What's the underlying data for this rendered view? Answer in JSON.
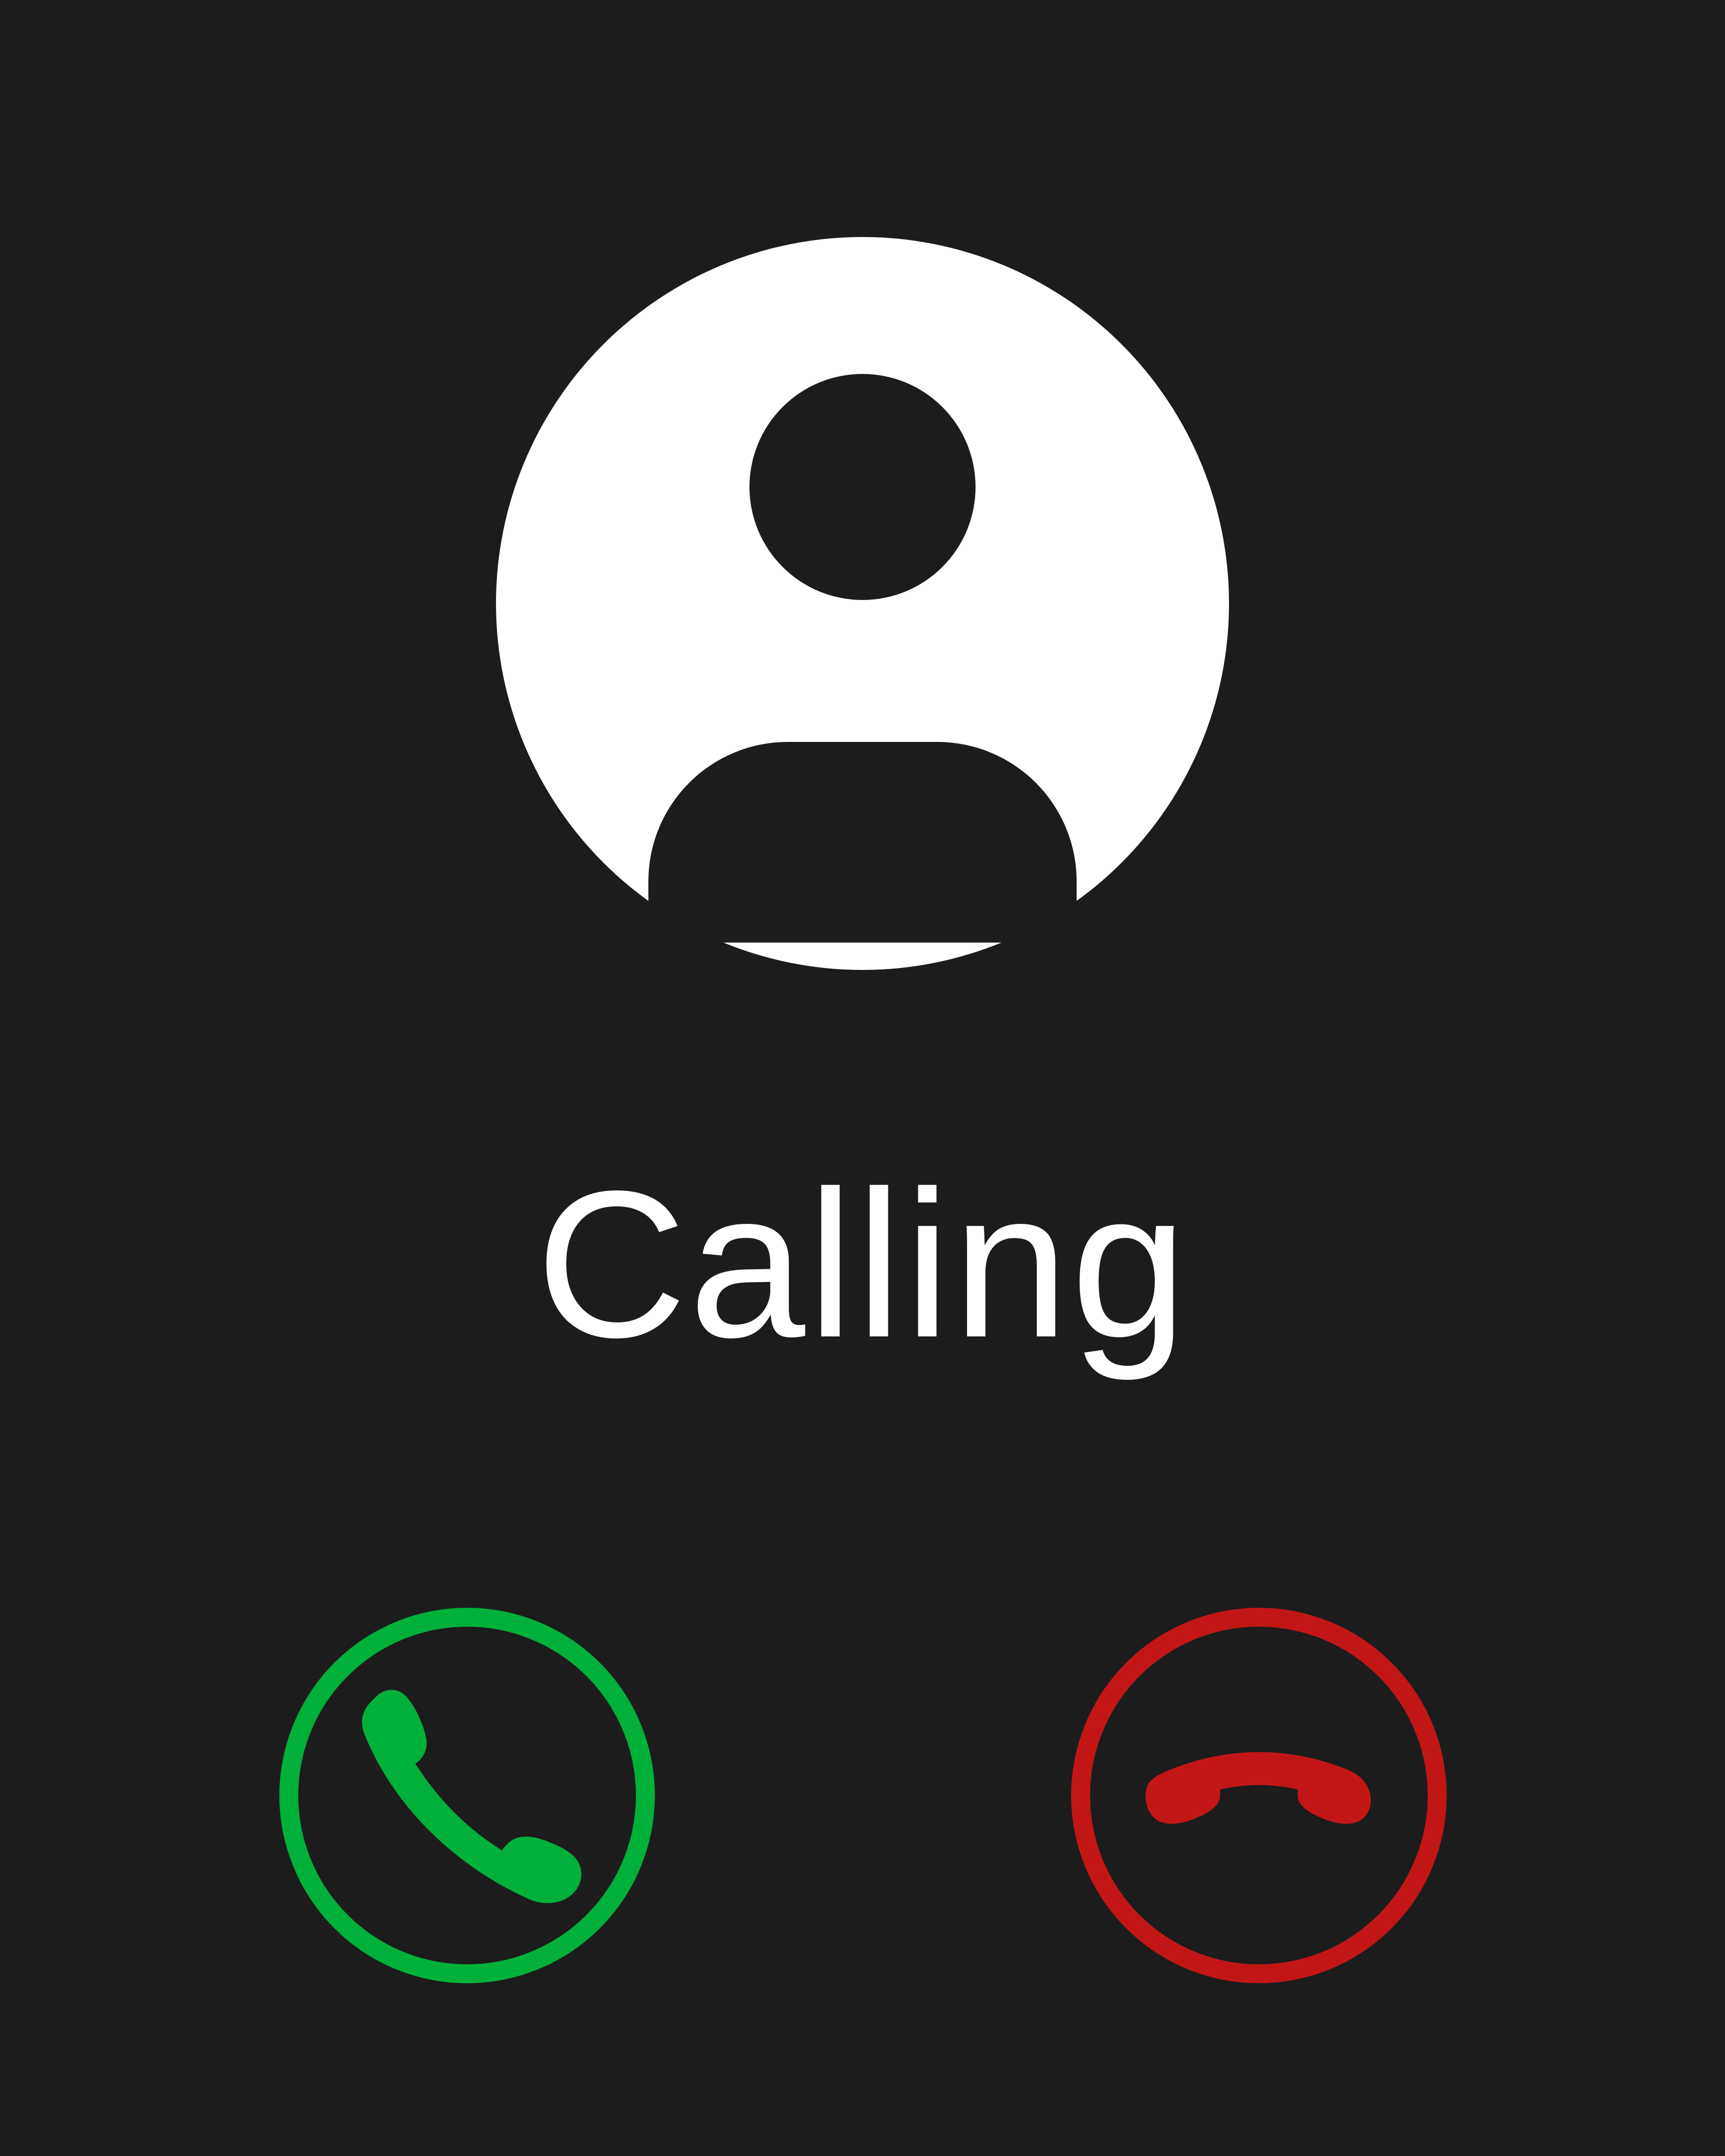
{
  "status": {
    "text": "Calling"
  },
  "avatar": {
    "icon": "user-icon",
    "background_color": "#ffffff",
    "figure_color": "#1c1c1c"
  },
  "actions": {
    "accept": {
      "icon": "phone-icon",
      "color": "#00b03a"
    },
    "decline": {
      "icon": "phone-hangup-icon",
      "color": "#c21616"
    }
  },
  "colors": {
    "background": "#1c1c1c",
    "text": "#ffffff"
  }
}
